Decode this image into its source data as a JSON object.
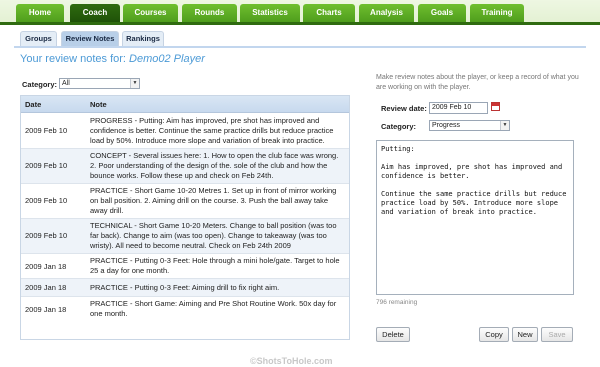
{
  "nav": {
    "tabs": [
      "Home",
      "Coach",
      "Courses",
      "Rounds",
      "Statistics",
      "Charts",
      "Analysis",
      "Goals",
      "Training"
    ],
    "active": "Coach"
  },
  "subnav": {
    "tabs": [
      "Groups",
      "Review Notes",
      "Rankings"
    ],
    "active": "Review Notes"
  },
  "heading": {
    "prefix": "Your review notes for:",
    "player": "Demo02 Player"
  },
  "filter": {
    "label": "Category:",
    "value": "All"
  },
  "table": {
    "headers": [
      "Date",
      "Note"
    ],
    "rows": [
      {
        "date": "2009 Feb 10",
        "note": "PROGRESS - Putting: Aim has improved, pre shot has improved and confidence is better. Continue the same practice drills but reduce practice load by 50%. Introduce more slope and variation of break into practice."
      },
      {
        "date": "2009 Feb 10",
        "note": "CONCEPT - Several issues here: 1. How to open the club face was wrong. 2. Poor understanding of the design of the. sole of the club and how the bounce works. Follow these up and check on Feb 24th."
      },
      {
        "date": "2009 Feb 10",
        "note": "PRACTICE - Short Game 10-20 Metres 1. Set up in front of mirror working on ball position. 2. Aiming drill on the course. 3. Push the ball away take away drill."
      },
      {
        "date": "2009 Feb 10",
        "note": "TECHNICAL - Short Game 10-20 Meters. Change to ball position (was too far back). Change to aim (was too open). Change to takeaway (was too wristy). All need to become neutral. Check on Feb 24th 2009"
      },
      {
        "date": "2009 Jan 18",
        "note": "PRACTICE - Putting 0-3 Feet: Hole through a mini hole/gate. Target to hole 25 a day for one month."
      },
      {
        "date": "2009 Jan 18",
        "note": "PRACTICE - Putting 0-3 Feet: Aiming drill to fix right aim."
      },
      {
        "date": "2009 Jan 18",
        "note": "PRACTICE - Short Game: Aiming and Pre Shot Routine Work. 50x day for one month."
      }
    ]
  },
  "editor": {
    "help": "Make review notes about the player, or keep a record of what you are working on with the player.",
    "review_date_label": "Review date:",
    "review_date_value": "2009 Feb 10",
    "category_label": "Category:",
    "category_value": "Progress",
    "notes_text": "Putting:\n\nAim has improved, pre shot has improved and confidence is better.\n\nContinue the same practice drills but reduce practice load by 50%. Introduce more slope and variation of break into practice.",
    "remaining": "796 remaining",
    "buttons": {
      "delete": "Delete",
      "copy": "Copy",
      "new": "New",
      "save": "Save"
    }
  },
  "watermark": "©ShotsToHole.com",
  "colors": {
    "nav_green": "#4f9d1d",
    "nav_active": "#2f6b10",
    "heading_blue": "#4c9ad6"
  }
}
